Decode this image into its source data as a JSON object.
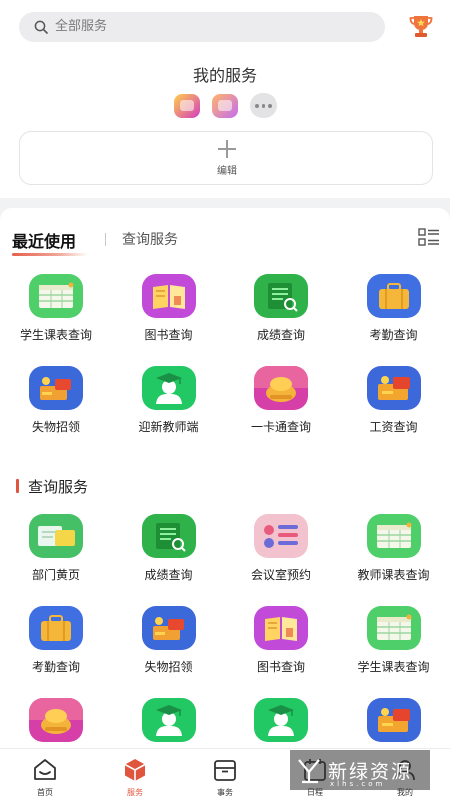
{
  "search": {
    "placeholder": "全部服务"
  },
  "my_services": {
    "title": "我的服务",
    "pinned_icons": [
      "folder-gold-icon",
      "book-open-icon",
      "more-dots-icon"
    ],
    "edit_label": "编辑"
  },
  "tabs": [
    {
      "label": "最近使用",
      "active": true
    },
    {
      "label": "查询服务",
      "active": false
    }
  ],
  "recent": [
    {
      "label": "学生课表查询",
      "icon": "timetable-icon"
    },
    {
      "label": "图书查询",
      "icon": "book-icon"
    },
    {
      "label": "成绩查询",
      "icon": "grade-search-icon"
    },
    {
      "label": "考勤查询",
      "icon": "briefcase-icon"
    },
    {
      "label": "失物招领",
      "icon": "lost-found-icon"
    },
    {
      "label": "迎新教师端",
      "icon": "graduate-icon"
    },
    {
      "label": "一卡通查询",
      "icon": "card-wallet-icon"
    },
    {
      "label": "工资查询",
      "icon": "salary-icon"
    }
  ],
  "query_section": {
    "title": "查询服务",
    "items": [
      {
        "label": "部门黄页",
        "icon": "yellow-pages-icon"
      },
      {
        "label": "成绩查询",
        "icon": "grade-search-icon"
      },
      {
        "label": "会议室预约",
        "icon": "meeting-room-icon"
      },
      {
        "label": "教师课表查询",
        "icon": "timetable-icon"
      },
      {
        "label": "考勤查询",
        "icon": "briefcase-icon"
      },
      {
        "label": "失物招领",
        "icon": "lost-found-icon"
      },
      {
        "label": "图书查询",
        "icon": "book-icon"
      },
      {
        "label": "学生课表查询",
        "icon": "timetable-icon"
      },
      {
        "label": "",
        "icon": "card-wallet-icon"
      },
      {
        "label": "",
        "icon": "graduate-icon"
      },
      {
        "label": "",
        "icon": "graduate-icon"
      },
      {
        "label": "",
        "icon": "salary-icon"
      }
    ]
  },
  "tabbar": [
    {
      "label": "首页",
      "icon": "home-icon",
      "active": false
    },
    {
      "label": "服务",
      "icon": "service-cube-icon",
      "active": true
    },
    {
      "label": "事务",
      "icon": "briefcase-outline-icon",
      "active": false
    },
    {
      "label": "日程",
      "icon": "calendar-icon",
      "active": false
    },
    {
      "label": "我的",
      "icon": "profile-icon",
      "active": false
    }
  ],
  "watermark": {
    "text": "新绿资源网",
    "subtext": "xlhs.com"
  },
  "colors": {
    "accent": "#e0553d",
    "background": "#f1f2f4"
  }
}
